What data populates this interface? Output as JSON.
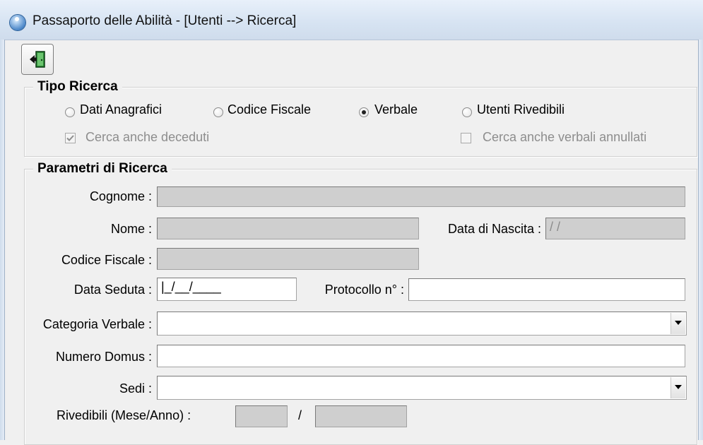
{
  "window": {
    "title": "Passaporto delle Abilità - [Utenti --> Ricerca]",
    "icon": "app-logo-icon"
  },
  "toolbar": {
    "exit_icon": "exit-door-icon"
  },
  "tipo_ricerca": {
    "title": "Tipo Ricerca",
    "options": [
      {
        "label": "Dati Anagrafici",
        "checked": false
      },
      {
        "label": "Codice Fiscale",
        "checked": false
      },
      {
        "label": "Verbale",
        "checked": true
      },
      {
        "label": "Utenti Rivedibili",
        "checked": false
      }
    ],
    "cerca_deceduti": {
      "label": "Cerca anche deceduti",
      "checked": true,
      "enabled": false
    },
    "cerca_annullati": {
      "label": "Cerca anche verbali annullati",
      "checked": false,
      "enabled": false
    }
  },
  "parametri": {
    "title": "Parametri di Ricerca",
    "cognome": {
      "label": "Cognome :",
      "value": ""
    },
    "nome": {
      "label": "Nome :",
      "value": ""
    },
    "data_nascita": {
      "label": "Data di Nascita :",
      "value": " /  /"
    },
    "codice_fiscale": {
      "label": "Codice Fiscale :",
      "value": ""
    },
    "data_seduta": {
      "label": "Data Seduta :",
      "value": "|_/__/____"
    },
    "protocollo": {
      "label": "Protocollo n° :",
      "value": ""
    },
    "categoria_verbale": {
      "label": "Categoria Verbale :",
      "value": ""
    },
    "numero_domus": {
      "label": "Numero Domus :",
      "value": ""
    },
    "sedi": {
      "label": "Sedi :",
      "value": ""
    },
    "rivedibili": {
      "label": "Rivedibili (Mese/Anno) :",
      "separator": "/",
      "mese": "",
      "anno": ""
    }
  }
}
